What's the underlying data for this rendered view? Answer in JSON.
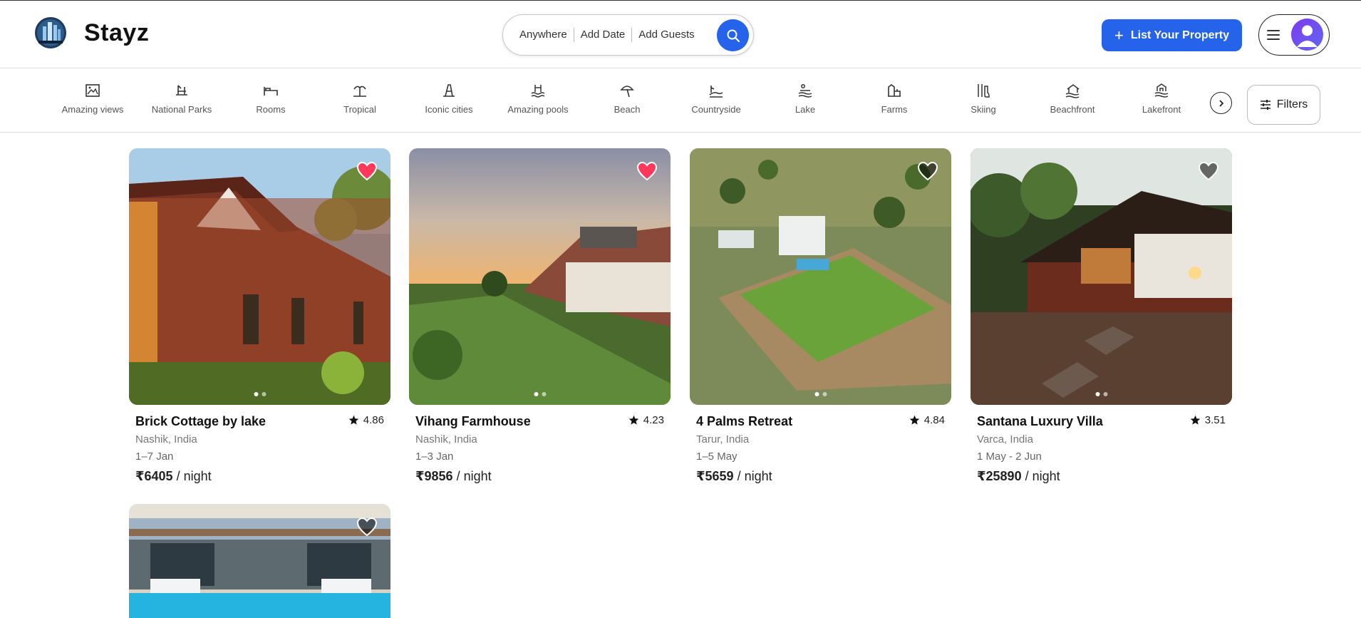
{
  "header": {
    "brand": "Stayz",
    "search": {
      "where": "Anywhere",
      "date": "Add Date",
      "guests": "Add Guests"
    },
    "list_property_label": "List Your Property"
  },
  "categories": [
    {
      "label": "Amazing views",
      "icon": "picture-frame-icon"
    },
    {
      "label": "National Parks",
      "icon": "park-icon"
    },
    {
      "label": "Rooms",
      "icon": "bed-icon"
    },
    {
      "label": "Tropical",
      "icon": "palm-tree-icon"
    },
    {
      "label": "Iconic cities",
      "icon": "tower-icon"
    },
    {
      "label": "Amazing pools",
      "icon": "pool-icon"
    },
    {
      "label": "Beach",
      "icon": "umbrella-icon"
    },
    {
      "label": "Countryside",
      "icon": "countryside-icon"
    },
    {
      "label": "Lake",
      "icon": "lake-icon"
    },
    {
      "label": "Farms",
      "icon": "farm-icon"
    },
    {
      "label": "Skiing",
      "icon": "skiing-icon"
    },
    {
      "label": "Beachfront",
      "icon": "beachfront-icon"
    },
    {
      "label": "Lakefront",
      "icon": "lakefront-icon"
    }
  ],
  "filters_label": "Filters",
  "listings": [
    {
      "title": "Brick Cottage by lake",
      "rating": "4.86",
      "location": "Nashik, India",
      "dates": "1–7 Jan",
      "price": "₹6405",
      "unit": "/ night",
      "favorited": true
    },
    {
      "title": "Vihang Farmhouse",
      "rating": "4.23",
      "location": "Nashik, India",
      "dates": "1–3 Jan",
      "price": "₹9856",
      "unit": "/ night",
      "favorited": true
    },
    {
      "title": "4 Palms Retreat",
      "rating": "4.84",
      "location": "Tarur, India",
      "dates": "1–5 May",
      "price": "₹5659",
      "unit": "/ night",
      "favorited": false
    },
    {
      "title": "Santana Luxury Villa",
      "rating": "3.51",
      "location": "Varca, India",
      "dates": "1 May - 2 Jun",
      "price": "₹25890",
      "unit": "/ night",
      "favorited": false
    },
    {
      "title": "",
      "rating": "",
      "location": "",
      "dates": "",
      "price": "",
      "unit": "",
      "favorited": false
    }
  ],
  "colors": {
    "accent": "#2563eb",
    "favorite": "#ff385c"
  }
}
